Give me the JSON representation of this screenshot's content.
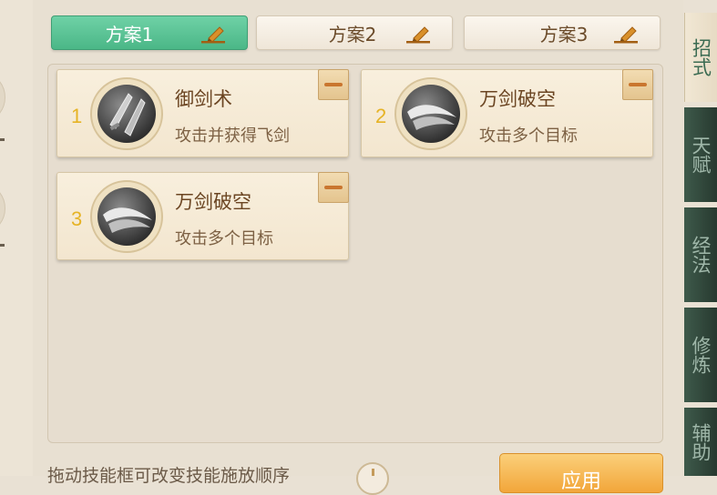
{
  "plans": [
    {
      "label": "方案1",
      "active": true
    },
    {
      "label": "方案2",
      "active": false
    },
    {
      "label": "方案3",
      "active": false
    }
  ],
  "skills": [
    {
      "slot": "1",
      "name": "御剑术",
      "desc": "攻击并获得飞剑",
      "icon": "flying-swords-icon"
    },
    {
      "slot": "2",
      "name": "万剑破空",
      "desc": "攻击多个目标",
      "icon": "sword-strike-icon"
    },
    {
      "slot": "3",
      "name": "万剑破空",
      "desc": "攻击多个目标",
      "icon": "sword-strike-icon"
    }
  ],
  "side_tabs": [
    {
      "label": "招式",
      "active": true
    },
    {
      "label": "天赋",
      "active": false
    },
    {
      "label": "经法",
      "active": false
    },
    {
      "label": "修炼",
      "active": false
    },
    {
      "label": "辅助",
      "active": false
    }
  ],
  "footer": {
    "hint": "拖动技能框可改变技能施放顺序",
    "apply_label": "应用"
  },
  "colors": {
    "active_tab": "#5cc495",
    "apply_button": "#f5b04a",
    "slot_number": "#e6b325"
  }
}
